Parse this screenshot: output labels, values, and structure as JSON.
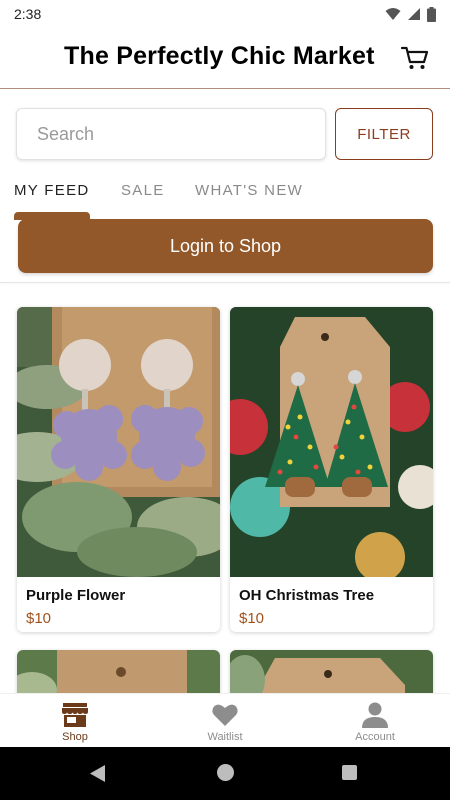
{
  "status_bar": {
    "time": "2:38",
    "icons": [
      "wifi-icon",
      "signal-icon",
      "battery-icon"
    ]
  },
  "header": {
    "title": "The Perfectly Chic Market",
    "cart_icon": "cart-icon"
  },
  "search": {
    "placeholder": "Search",
    "value": ""
  },
  "filter": {
    "label": "FILTER"
  },
  "tabs": [
    {
      "label": "MY FEED",
      "active": true
    },
    {
      "label": "SALE",
      "active": false
    },
    {
      "label": "WHAT'S NEW",
      "active": false
    }
  ],
  "login": {
    "label": "Login to Shop"
  },
  "products": [
    {
      "name": "Purple Flower",
      "price": "$10"
    },
    {
      "name": "OH Christmas Tree",
      "price": "$10"
    }
  ],
  "bottom_nav": [
    {
      "label": "Shop",
      "icon": "store-icon",
      "active": true
    },
    {
      "label": "Waitlist",
      "icon": "heart-icon",
      "active": false
    },
    {
      "label": "Account",
      "icon": "person-icon",
      "active": false
    }
  ],
  "colors": {
    "accent": "#93582a",
    "price": "#a0521d",
    "filter_border": "#8a3d1e"
  }
}
